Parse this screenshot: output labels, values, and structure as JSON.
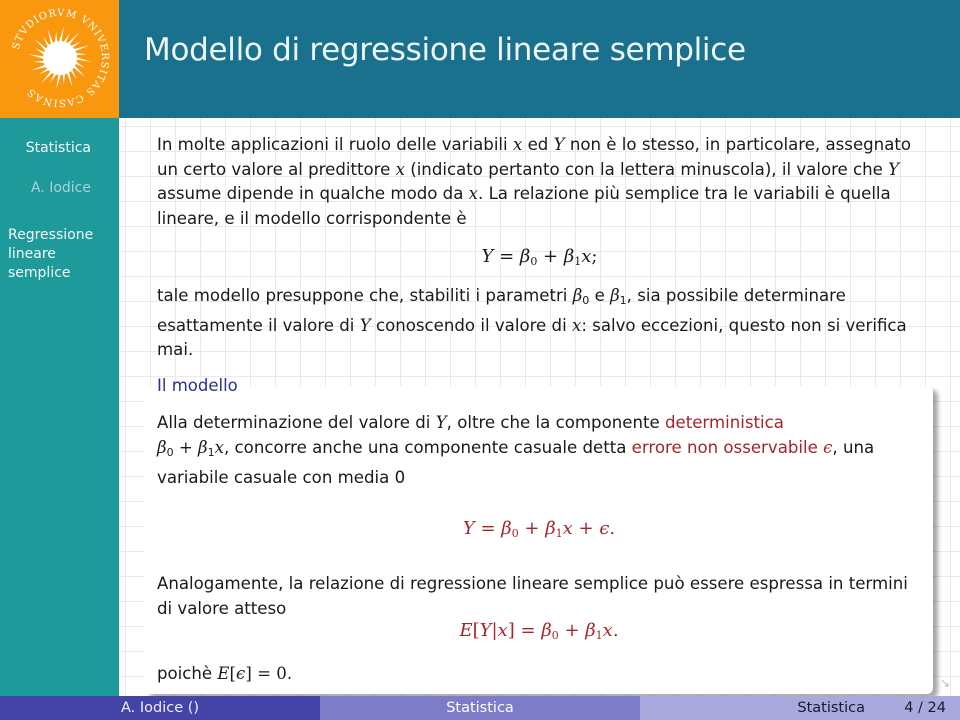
{
  "logo": {
    "icon": "university-sun-seal-icon",
    "text": "STUDIORUM UNIVERSITAS CASINAS",
    "color": "#f9980f"
  },
  "header": {
    "title": "Modello di regressione lineare semplice",
    "color": "#1a718d"
  },
  "sidebar": {
    "course": "Statistica",
    "author": "A. Iodice",
    "section": "Regressione lineare semplice",
    "color": "#1d9a99"
  },
  "main": {
    "intro": {
      "l1a": "In molte applicazioni il ruolo delle variabili ",
      "x": "x",
      "l1b": " ed ",
      "Y": "Y",
      "l1c": " non è lo stesso, in particolare, assegnato un certo valore al predittore ",
      "l1d": " (indicato pertanto con la lettera minuscola), il valore che ",
      "l1e": " assume dipende in qualche modo da ",
      "l1f": ". La relazione più semplice tra le variabili è quella lineare, e il modello corrispondente è"
    },
    "eq1": "Y = β₀ + β₁x;",
    "after": {
      "a": "tale modello presuppone che, stabiliti i parametri ",
      "b0": "β",
      "sub0": "0",
      "b": " e ",
      "b1": "β",
      "sub1": "1",
      "c": ", sia possibile determinare esattamente il valore di ",
      "Y": "Y",
      "d": " conoscendo il valore di ",
      "x": "x",
      "e": ": salvo eccezioni, questo non si verifica mai."
    },
    "block": {
      "title": "Il modello",
      "p1a": "Alla determinazione del valore di ",
      "Y": "Y",
      "p1b": ", oltre che la componente ",
      "p1_red1": "deterministica",
      "p1c_beta0": "β",
      "p1c_sub0": "0",
      "p1c_plus": " + ",
      "p1c_beta1": "β",
      "p1c_sub1": "1",
      "p1c_x": "x",
      "p1d": ", concorre anche una componente casuale detta ",
      "p1_red2": "errore non osservabile ",
      "epsilon": "ϵ",
      "p1e": ", una variabile casuale con media 0",
      "eq2": {
        "Y": "Y",
        "eq": " = ",
        "beta": "β",
        "sub0": "0",
        "plus": " + ",
        "sub1": "1",
        "x": "x",
        "plus2": " + ",
        "eps": "ϵ",
        "end": "."
      },
      "p2": "Analogamente, la relazione di regressione lineare semplice può essere espressa in termini di valore atteso",
      "eq3": {
        "E": "E",
        "open": "[",
        "Y": "Y",
        "bar": "|",
        "x": "x",
        "close": "]",
        "eq": " = ",
        "beta": "β",
        "sub0": "0",
        "plus": " + ",
        "sub1": "1",
        "end": "."
      },
      "p3a": "poichè ",
      "p3_E": "E",
      "p3_open": "[",
      "p3_eps": "ϵ",
      "p3_close": "] = 0."
    },
    "accent_red": "#a2262c",
    "block_title_color": "#2c2f8c"
  },
  "nav": {
    "icon": "navigation-arrow-icon",
    "glyph": "↘"
  },
  "footer": {
    "author": "A. Iodice  ()",
    "title": "Statistica",
    "course": "Statistica",
    "page": "4 / 24",
    "current_page": 4,
    "total_pages": 24
  }
}
